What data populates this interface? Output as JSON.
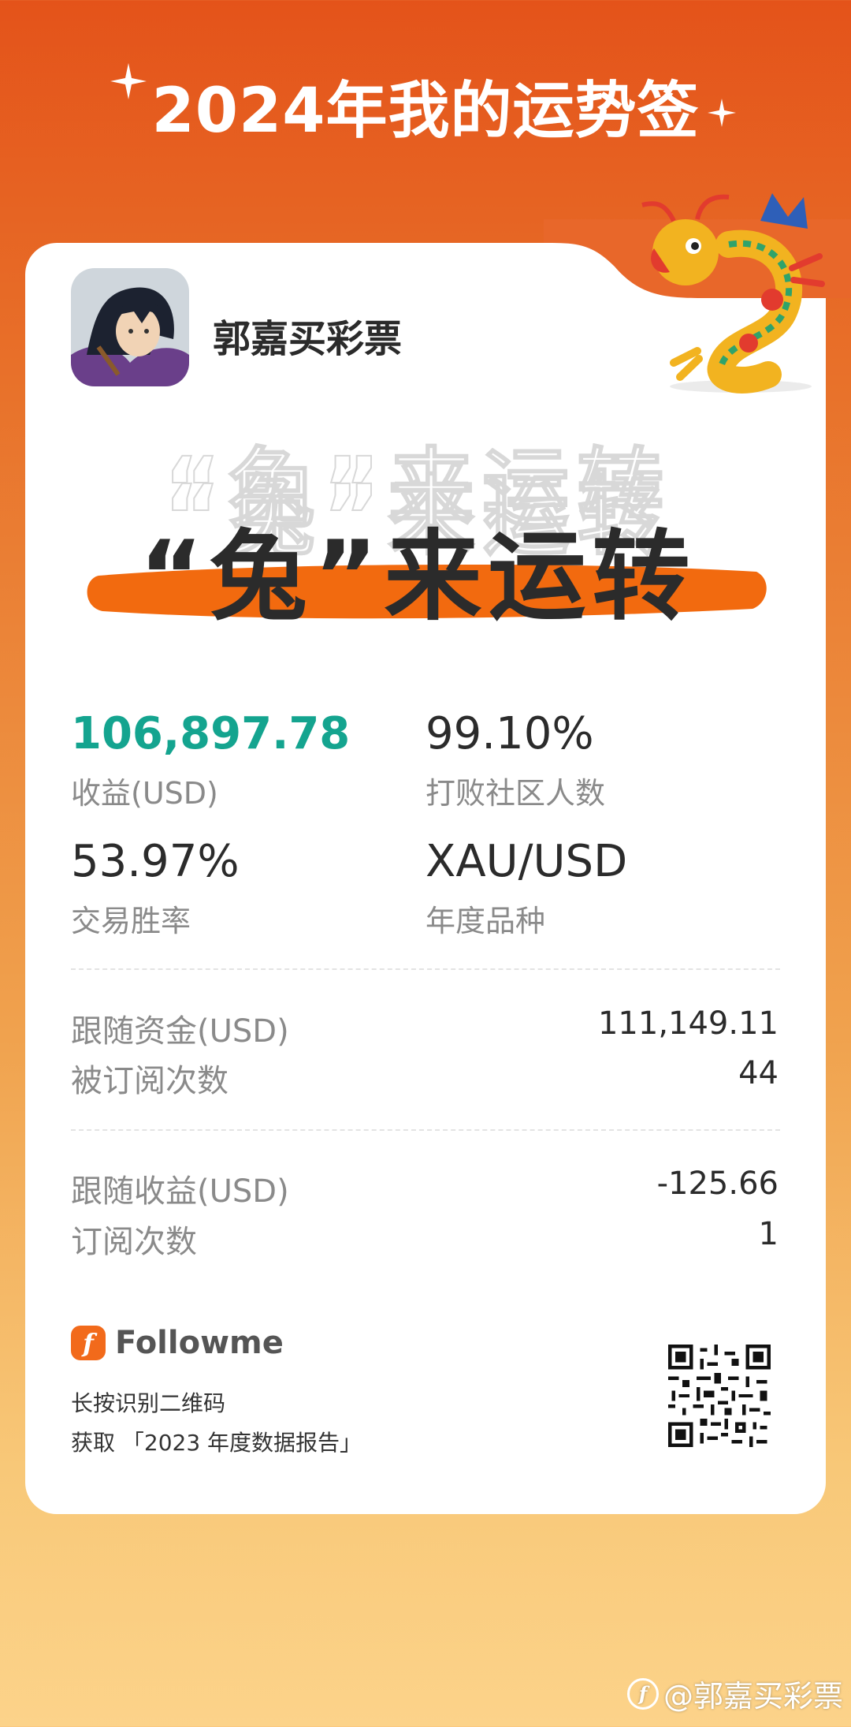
{
  "header": {
    "title": "2024年我的运势签"
  },
  "profile": {
    "username": "郭嘉买彩票"
  },
  "hero": {
    "slogan": "“兔”来运转"
  },
  "stats": [
    {
      "value": "106,897.78",
      "label": "收益(USD)"
    },
    {
      "value": "99.10%",
      "label": "打败社区人数"
    },
    {
      "value": "53.97%",
      "label": "交易胜率"
    },
    {
      "value": "XAU/USD",
      "label": "年度品种"
    }
  ],
  "follow_rows": [
    {
      "label": "跟随资金(USD)",
      "value": "111,149.11"
    },
    {
      "label": "被订阅次数",
      "value": "44"
    }
  ],
  "profit_rows": [
    {
      "label": "跟随收益(USD)",
      "value": "-125.66"
    },
    {
      "label": "订阅次数",
      "value": "1"
    }
  ],
  "footer": {
    "brand_name": "Followme",
    "brand_logo": "f",
    "line1": "长按识别二维码",
    "line2": "获取 「2023 年度数据报告」"
  },
  "watermark": {
    "text": "@郭嘉买彩票",
    "logo": "f"
  },
  "colors": {
    "accent": "#F26A1B",
    "teal": "#14A48F",
    "text": "#2b2b2b",
    "muted": "#8a8a8a"
  }
}
